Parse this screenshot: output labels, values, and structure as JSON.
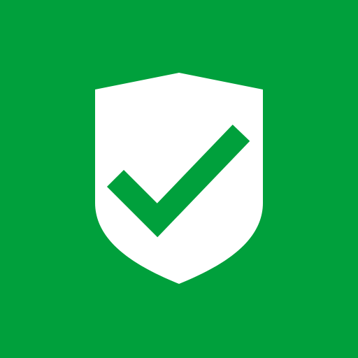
{
  "colors": {
    "background": "#00a03c",
    "shield": "#ffffff",
    "check": "#00a03c"
  },
  "icon": {
    "shield": "shield-icon",
    "check": "checkmark-icon"
  }
}
